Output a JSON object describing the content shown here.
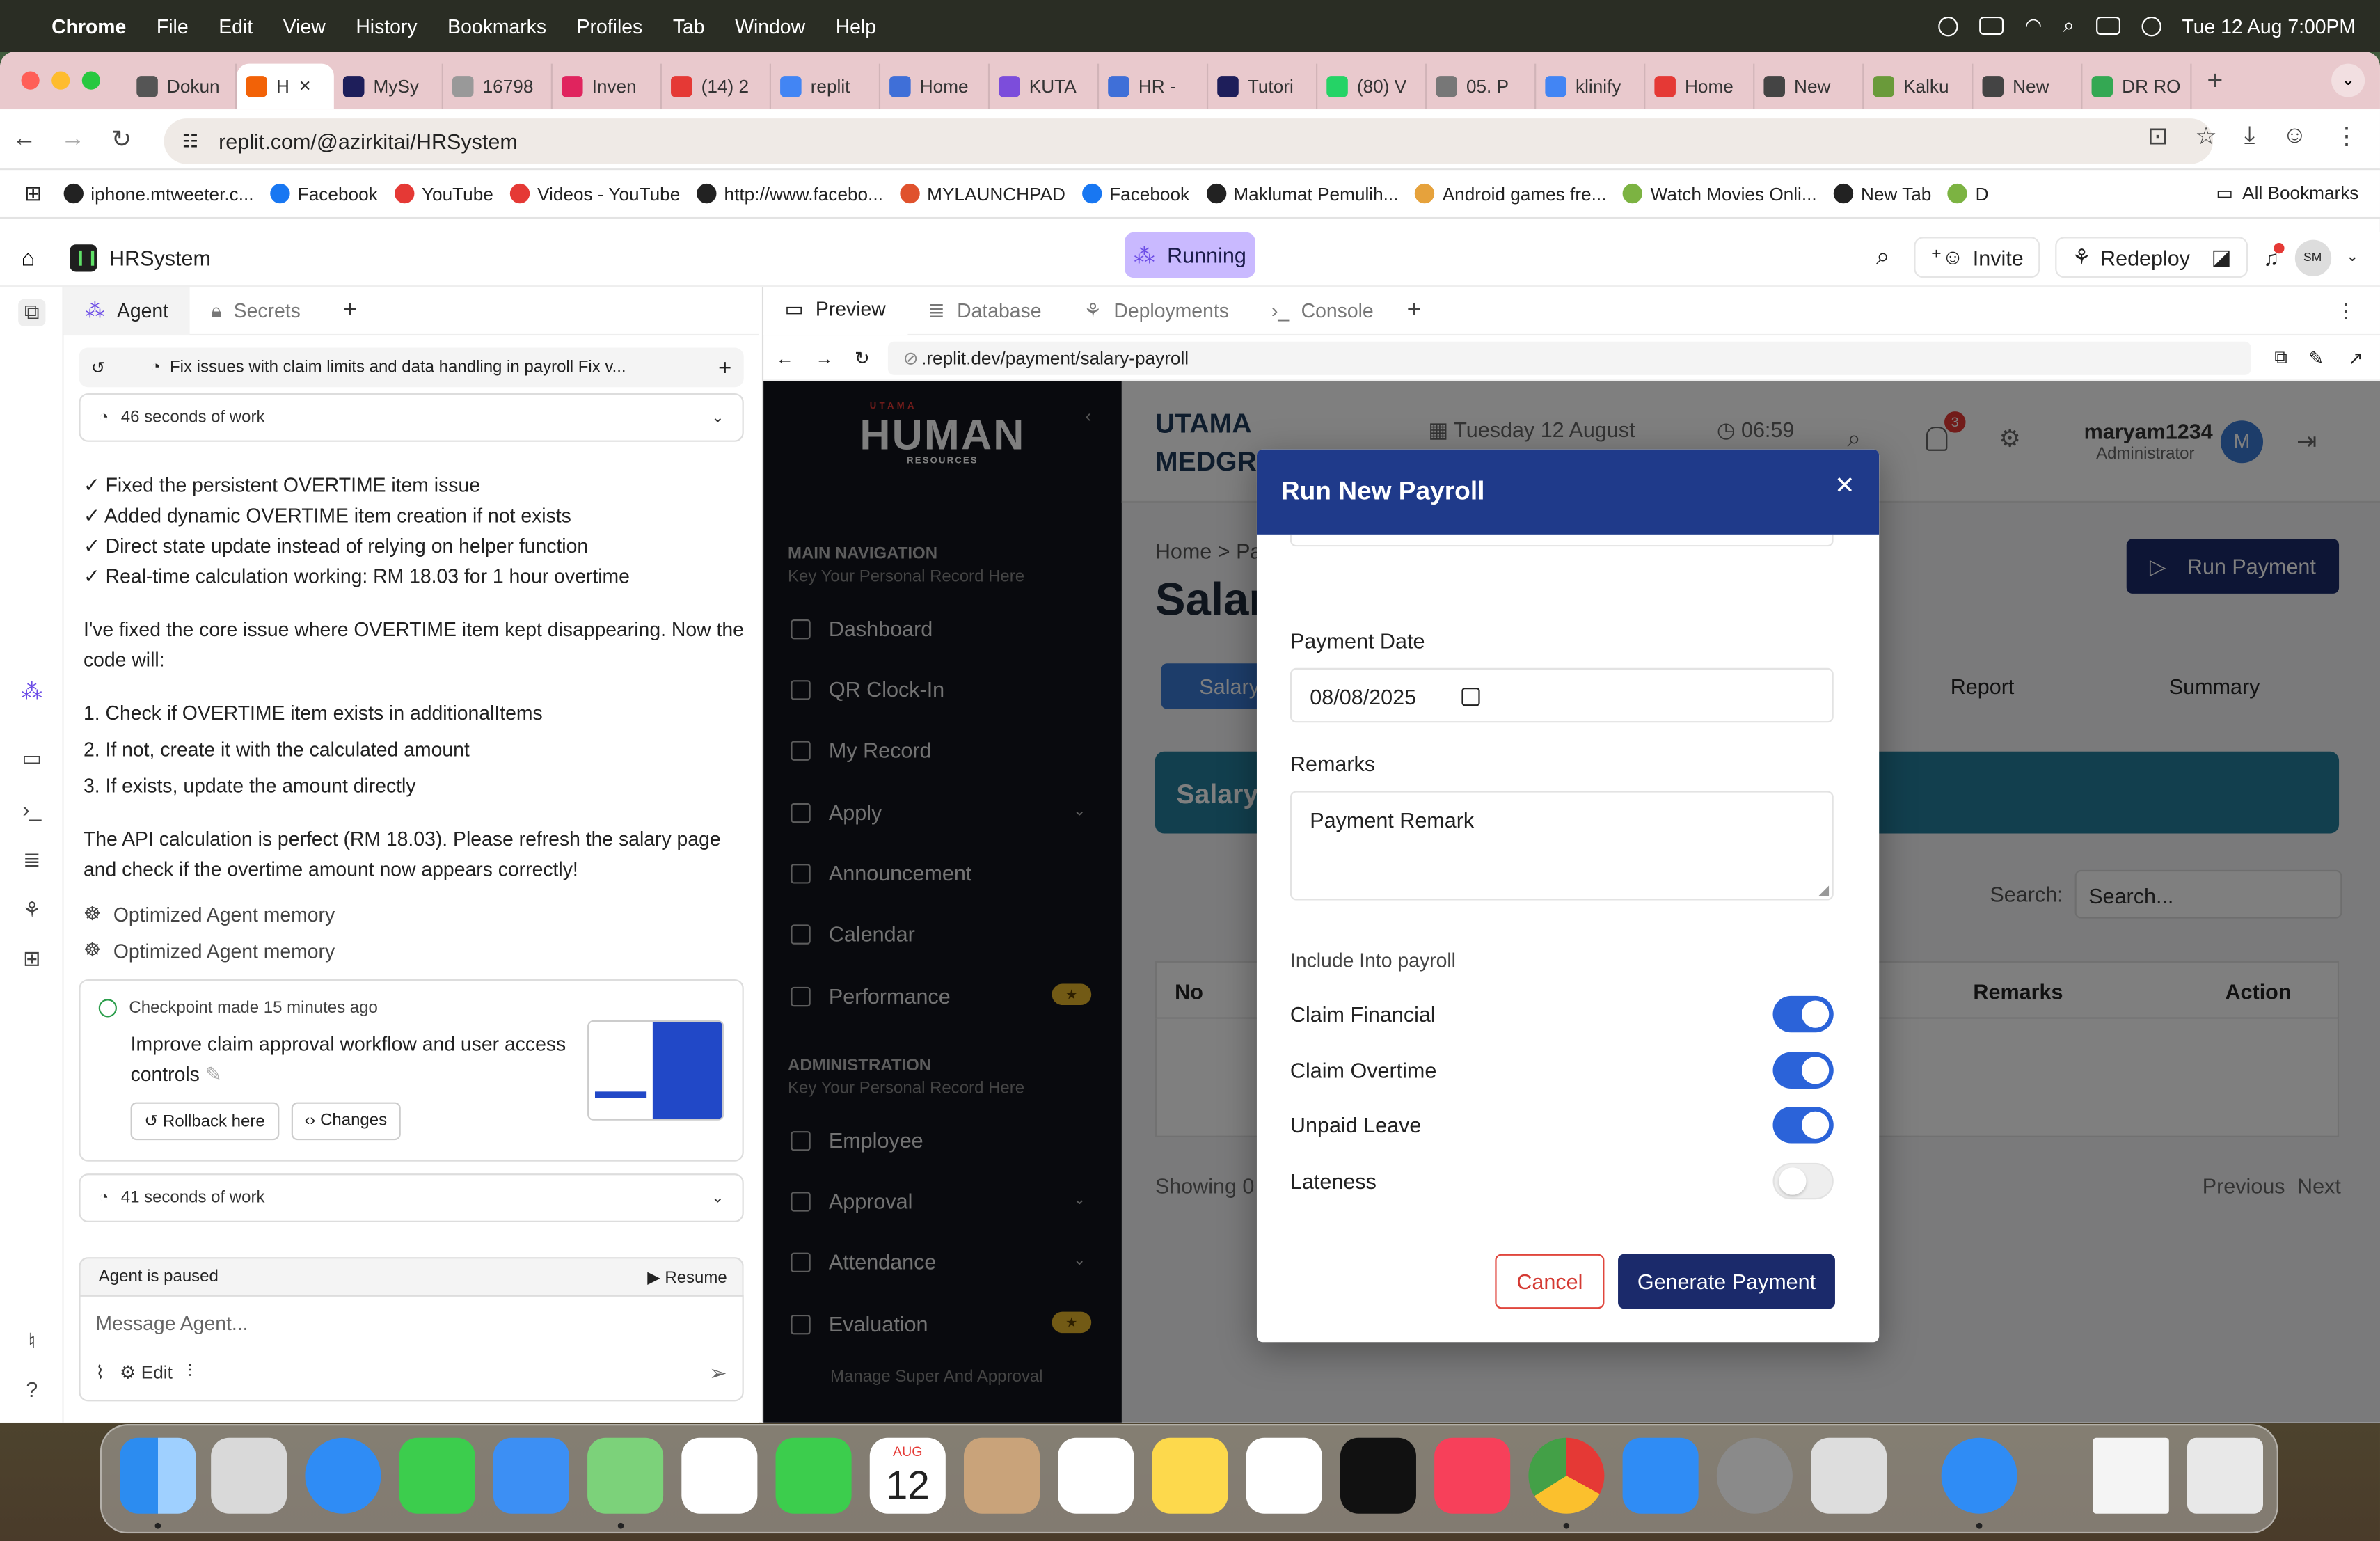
{
  "menubar": {
    "app": "Chrome",
    "items": [
      "File",
      "Edit",
      "View",
      "History",
      "Bookmarks",
      "Profiles",
      "Tab",
      "Window",
      "Help"
    ],
    "datetime": "Tue 12 Aug  7:00PM"
  },
  "browser_tabs": [
    {
      "label": "Dokun",
      "color": "#555"
    },
    {
      "label": "H",
      "color": "#f26207",
      "active": true
    },
    {
      "label": "MySy",
      "color": "#1e1e5a"
    },
    {
      "label": "16798",
      "color": "#999"
    },
    {
      "label": "Inven",
      "color": "#e0245e"
    },
    {
      "label": "(14) 2",
      "color": "#e53935"
    },
    {
      "label": "replit",
      "color": "#4285f4"
    },
    {
      "label": "Home",
      "color": "#3f6fd8"
    },
    {
      "label": "KUTA",
      "color": "#7c4ddb"
    },
    {
      "label": "HR -",
      "color": "#3f6fd8"
    },
    {
      "label": "Tutori",
      "color": "#1e1e5a"
    },
    {
      "label": "(80) V",
      "color": "#25d366"
    },
    {
      "label": "05. P",
      "color": "#777"
    },
    {
      "label": "klinify",
      "color": "#4285f4"
    },
    {
      "label": "Home",
      "color": "#e53935"
    },
    {
      "label": "New",
      "color": "#444"
    },
    {
      "label": "Kalku",
      "color": "#6a9a3a"
    },
    {
      "label": "New",
      "color": "#444"
    },
    {
      "label": "DR RO",
      "color": "#34a853"
    }
  ],
  "address": {
    "url": "replit.com/@azirkitai/HRSystem"
  },
  "bookmarks": [
    {
      "label": "iphone.mtweeter.c...",
      "color": "#222"
    },
    {
      "label": "Facebook",
      "color": "#1877f2"
    },
    {
      "label": "YouTube",
      "color": "#e53935"
    },
    {
      "label": "Videos - YouTube",
      "color": "#e53935"
    },
    {
      "label": "http://www.facebo...",
      "color": "#222"
    },
    {
      "label": "MYLAUNCHPAD",
      "color": "#e0522d"
    },
    {
      "label": "Facebook",
      "color": "#1877f2"
    },
    {
      "label": "Maklumat Pemulih...",
      "color": "#222"
    },
    {
      "label": "Android games fre...",
      "color": "#e6a23c"
    },
    {
      "label": "Watch Movies Onli...",
      "color": "#7cb342"
    },
    {
      "label": "New Tab",
      "color": "#222"
    },
    {
      "label": "D",
      "color": "#7cb342"
    }
  ],
  "all_bookmarks": "All Bookmarks",
  "replit": {
    "project": "HRSystem",
    "status": "Running",
    "invite": "Invite",
    "redeploy": "Redeploy",
    "avatar": "SM"
  },
  "agent": {
    "tabs": [
      "Agent",
      "Secrets"
    ],
    "task": "Fix issues with claim limits and data handling in payroll Fix v...",
    "work1": "46 seconds of work",
    "checks": [
      "✓ Fixed the persistent OVERTIME item issue",
      "✓ Added dynamic OVERTIME item creation if not exists",
      "✓ Direct state update instead of relying on helper function",
      "✓ Real-time calculation working: RM 18.03 for 1 hour overtime"
    ],
    "para1": "I've fixed the core issue where OVERTIME item kept disappearing. Now the code will:",
    "steps": [
      "1. Check if OVERTIME item exists in additionalItems",
      "2. If not, create it with the calculated amount",
      "3. If exists, update the amount directly"
    ],
    "para2": "The API calculation is perfect (RM 18.03). Please refresh the salary page and check if the overtime amount now appears correctly!",
    "memory": [
      "Optimized Agent memory",
      "Optimized Agent memory"
    ],
    "checkpoint": {
      "head": "Checkpoint made 15 minutes ago",
      "title": "Improve claim approval workflow and user access controls",
      "rollback": "Rollback here",
      "changes": "Changes"
    },
    "work2": "41 seconds of work",
    "paused": "Agent is paused",
    "resume": "Resume",
    "placeholder": "Message Agent...",
    "edit": "Edit"
  },
  "preview": {
    "tabs": [
      "Preview",
      "Database",
      "Deployments",
      "Console"
    ],
    "url": ".replit.dev/payment/salary-payroll"
  },
  "hr_app": {
    "logo": "HUMAN",
    "logo_sub": "RESOURCES",
    "logo_mark": "UTAMA",
    "main_nav": "MAIN NAVIGATION",
    "main_nav_sub": "Key Your Personal Record Here",
    "nav_main": [
      "Dashboard",
      "QR Clock-In",
      "My Record",
      "Apply",
      "Announcement",
      "Calendar",
      "Performance"
    ],
    "admin_nav": "ADMINISTRATION",
    "admin_nav_sub": "Key Your Personal Record Here",
    "nav_admin": [
      "Employee",
      "Approval",
      "Attendance",
      "Evaluation"
    ],
    "nav_footer": "Manage Super And Approval",
    "company": "UTAMA MEDGRO",
    "date": "Tuesday 12 August",
    "time": "06:59",
    "notif_count": "3",
    "user": "maryam1234",
    "role": "Administrator",
    "avatar": "M",
    "crumb": "Home > Pa",
    "page_title": "Salar",
    "run_payment": "Run Payment",
    "subtabs": [
      "Salary",
      "Report",
      "Summary"
    ],
    "banner": "Salary",
    "search_label": "Search:",
    "search_placeholder": "Search...",
    "columns": [
      "No",
      "Remarks",
      "Action"
    ],
    "showing": "Showing 0",
    "previous": "Previous",
    "next": "Next"
  },
  "modal": {
    "title": "Run New Payroll",
    "payment_date_label": "Payment Date",
    "payment_date": "08/08/2025",
    "remarks_label": "Remarks",
    "remarks": "Payment Remark",
    "include_label": "Include Into payroll",
    "toggles": [
      {
        "label": "Claim Financial",
        "on": true
      },
      {
        "label": "Claim Overtime",
        "on": true
      },
      {
        "label": "Unpaid Leave",
        "on": true
      },
      {
        "label": "Lateness",
        "on": false
      }
    ],
    "cancel": "Cancel",
    "generate": "Generate Payment"
  },
  "dock": {
    "calendar_month": "AUG",
    "calendar_day": "12"
  }
}
